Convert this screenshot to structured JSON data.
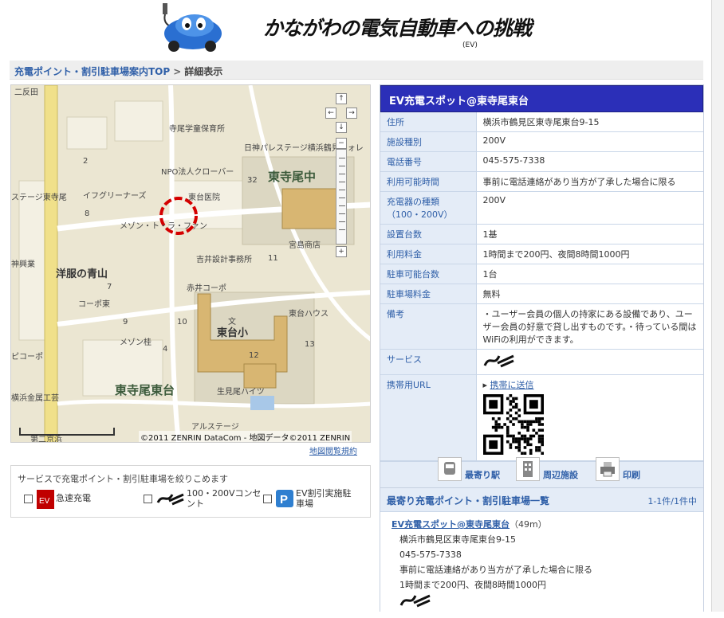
{
  "header": {
    "title": "かながわの電気自動車への挑戦",
    "subtitle": "(EV)"
  },
  "breadcrumb": {
    "top_link": "充電ポイント・割引駐車場案内TOP",
    "separator": ">",
    "current": "詳細表示"
  },
  "map": {
    "labels": {
      "nifuda": "二反田",
      "hoikuen": "寺尾学童保育所",
      "nichiei": "日神パレステージ横浜鶴見フォレ",
      "npo": "NPO法人クローバー",
      "higashiterao_naka": "東寺尾中",
      "stage": "ステージ東寺尾",
      "infrinas": "イフグリーナーズ",
      "iin": "東台医院",
      "maison": "メゾン・ト・ラ・ファン",
      "miyajima": "宮島商店",
      "yoshii": "吉井設計事務所",
      "jinbo": "神興業",
      "aoyama": "洋服の青山",
      "akai": "赤井コーポ",
      "kopo": "コーポ東",
      "bun": "文",
      "higashidai_sho": "東台小",
      "haus": "東台ハウス",
      "maison2": "メゾン桂",
      "koopo2": "ピコーポ",
      "higashiterao_higashidai": "東寺尾東台",
      "ikumi": "生見尾ハイツ",
      "kinzoku": "横浜金属工芸",
      "alstage": "アルステージ",
      "daini": "第二京浜",
      "n8": "8",
      "n7": "7",
      "n9": "9",
      "n10": "10",
      "n11": "11",
      "n12": "12",
      "n13": "13",
      "n32": "32",
      "n2": "2",
      "n4": "4"
    },
    "copyright": "©2011 ZENRIN DataCom - 地図データ©2011 ZENRIN",
    "terms_link": "地図閲覧規約",
    "nav": {
      "up": "↑",
      "down": "↓",
      "left": "←",
      "right": "→",
      "zoom_in": "+",
      "zoom_out": "−"
    }
  },
  "filter": {
    "title": "サービスで充電ポイント・割引駐車場を絞りこめます",
    "options": [
      {
        "label": "急速充電",
        "checked": false
      },
      {
        "label": "100・200Vコンセント",
        "checked": false
      },
      {
        "label": "EV割引実施駐車場",
        "checked": false
      }
    ]
  },
  "detail": {
    "title": "EV充電スポット@東寺尾東台",
    "rows": [
      {
        "key": "住所",
        "value": "横浜市鶴見区東寺尾東台9-15"
      },
      {
        "key": "施設種別",
        "value": "200V"
      },
      {
        "key": "電話番号",
        "value": "045-575-7338"
      },
      {
        "key": "利用可能時間",
        "value": "事前に電話連絡があり当方が了承した場合に限る"
      },
      {
        "key": "充電器の種類（100・200V）",
        "value": "200V"
      },
      {
        "key": "設置台数",
        "value": "1基"
      },
      {
        "key": "利用料金",
        "value": "1時間まで200円、夜間8時間1000円"
      },
      {
        "key": "駐車可能台数",
        "value": "1台"
      },
      {
        "key": "駐車場料金",
        "value": "無料"
      },
      {
        "key": "備考",
        "value": "・ユーザー会員の個人の持家にある設備であり、ユーザー会員の好意で貸し出すものです。・待っている間はWiFiの利用ができます。"
      }
    ],
    "service_key": "サービス",
    "mobile_key": "携帯用URL",
    "send_link": "携帯に送信",
    "actions": {
      "station": "最寄り駅",
      "facilities": "周辺施設",
      "print": "印刷"
    }
  },
  "nearby": {
    "title": "最寄り充電ポイント・割引駐車場一覧",
    "count": "1-1件/1件中",
    "items": [
      {
        "name": "EV充電スポット@東寺尾東台",
        "distance": "（49m）",
        "address": "横浜市鶴見区東寺尾東台9-15",
        "phone": "045-575-7338",
        "hours": "事前に電話連絡があり当方が了承した場合に限る",
        "fee": "1時間まで200円、夜間8時間1000円"
      }
    ]
  },
  "colors": {
    "header_blue": "#2b2fb8",
    "link_blue": "#2f5fa8",
    "key_bg": "#e4ecf7",
    "map_bg": "#ece7d3",
    "marker_red": "#d40000"
  }
}
